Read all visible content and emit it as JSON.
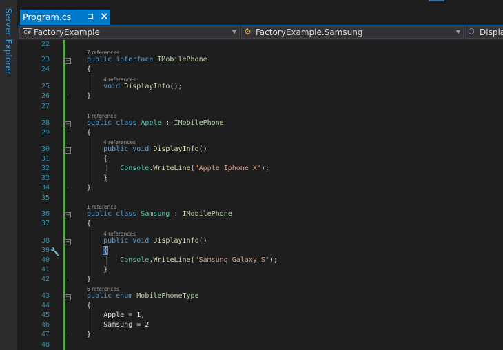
{
  "sidebar": {
    "label": "Server Explorer"
  },
  "tab": {
    "title": "Program.cs",
    "pin": "⊐",
    "close": "✕"
  },
  "nav": {
    "project": "FactoryExample",
    "class": "FactoryExample.Samsung",
    "member": "Display"
  },
  "icons": {
    "project": "csharp-project-icon",
    "class": "class-icon",
    "member": "method-icon"
  },
  "colors": {
    "accent": "#007acc",
    "background": "#1e1e1e",
    "keyword": "#569cd6",
    "type": "#4ec9b0"
  },
  "lines": [
    {
      "n": "22",
      "t": ""
    },
    {
      "n": "23",
      "t": "public interface IMobilePhone"
    },
    {
      "n": "24",
      "t": "{"
    },
    {
      "n": "25",
      "t": "    void DisplayInfo();"
    },
    {
      "n": "26",
      "t": "}"
    },
    {
      "n": "27",
      "t": ""
    },
    {
      "n": "28",
      "t": "public class Apple : IMobilePhone"
    },
    {
      "n": "29",
      "t": "{"
    },
    {
      "n": "30",
      "t": "    public void DisplayInfo()"
    },
    {
      "n": "31",
      "t": "    {"
    },
    {
      "n": "32",
      "t": "        Console.WriteLine(\"Apple Iphone X\");"
    },
    {
      "n": "33",
      "t": "    }"
    },
    {
      "n": "34",
      "t": "}"
    },
    {
      "n": "35",
      "t": ""
    },
    {
      "n": "36",
      "t": "public class Samsung : IMobilePhone"
    },
    {
      "n": "37",
      "t": "{"
    },
    {
      "n": "38",
      "t": "    public void DisplayInfo()"
    },
    {
      "n": "39",
      "t": "    {"
    },
    {
      "n": "40",
      "t": "        Console.WriteLine(\"Samsung Galaxy S\");"
    },
    {
      "n": "41",
      "t": "    }"
    },
    {
      "n": "42",
      "t": "}"
    },
    {
      "n": "43",
      "t": "public enum MobilePhoneType"
    },
    {
      "n": "44",
      "t": "{"
    },
    {
      "n": "45",
      "t": "    Apple = 1,"
    },
    {
      "n": "46",
      "t": "    Samsung = 2"
    },
    {
      "n": "47",
      "t": "}"
    },
    {
      "n": "48",
      "t": ""
    }
  ],
  "lens": [
    {
      "t": "7 references"
    },
    {
      "t": "4 references"
    },
    {
      "t": "1 reference"
    },
    {
      "t": "4 references"
    },
    {
      "t": "1 reference"
    },
    {
      "t": "4 references"
    },
    {
      "t": "6 references"
    }
  ]
}
